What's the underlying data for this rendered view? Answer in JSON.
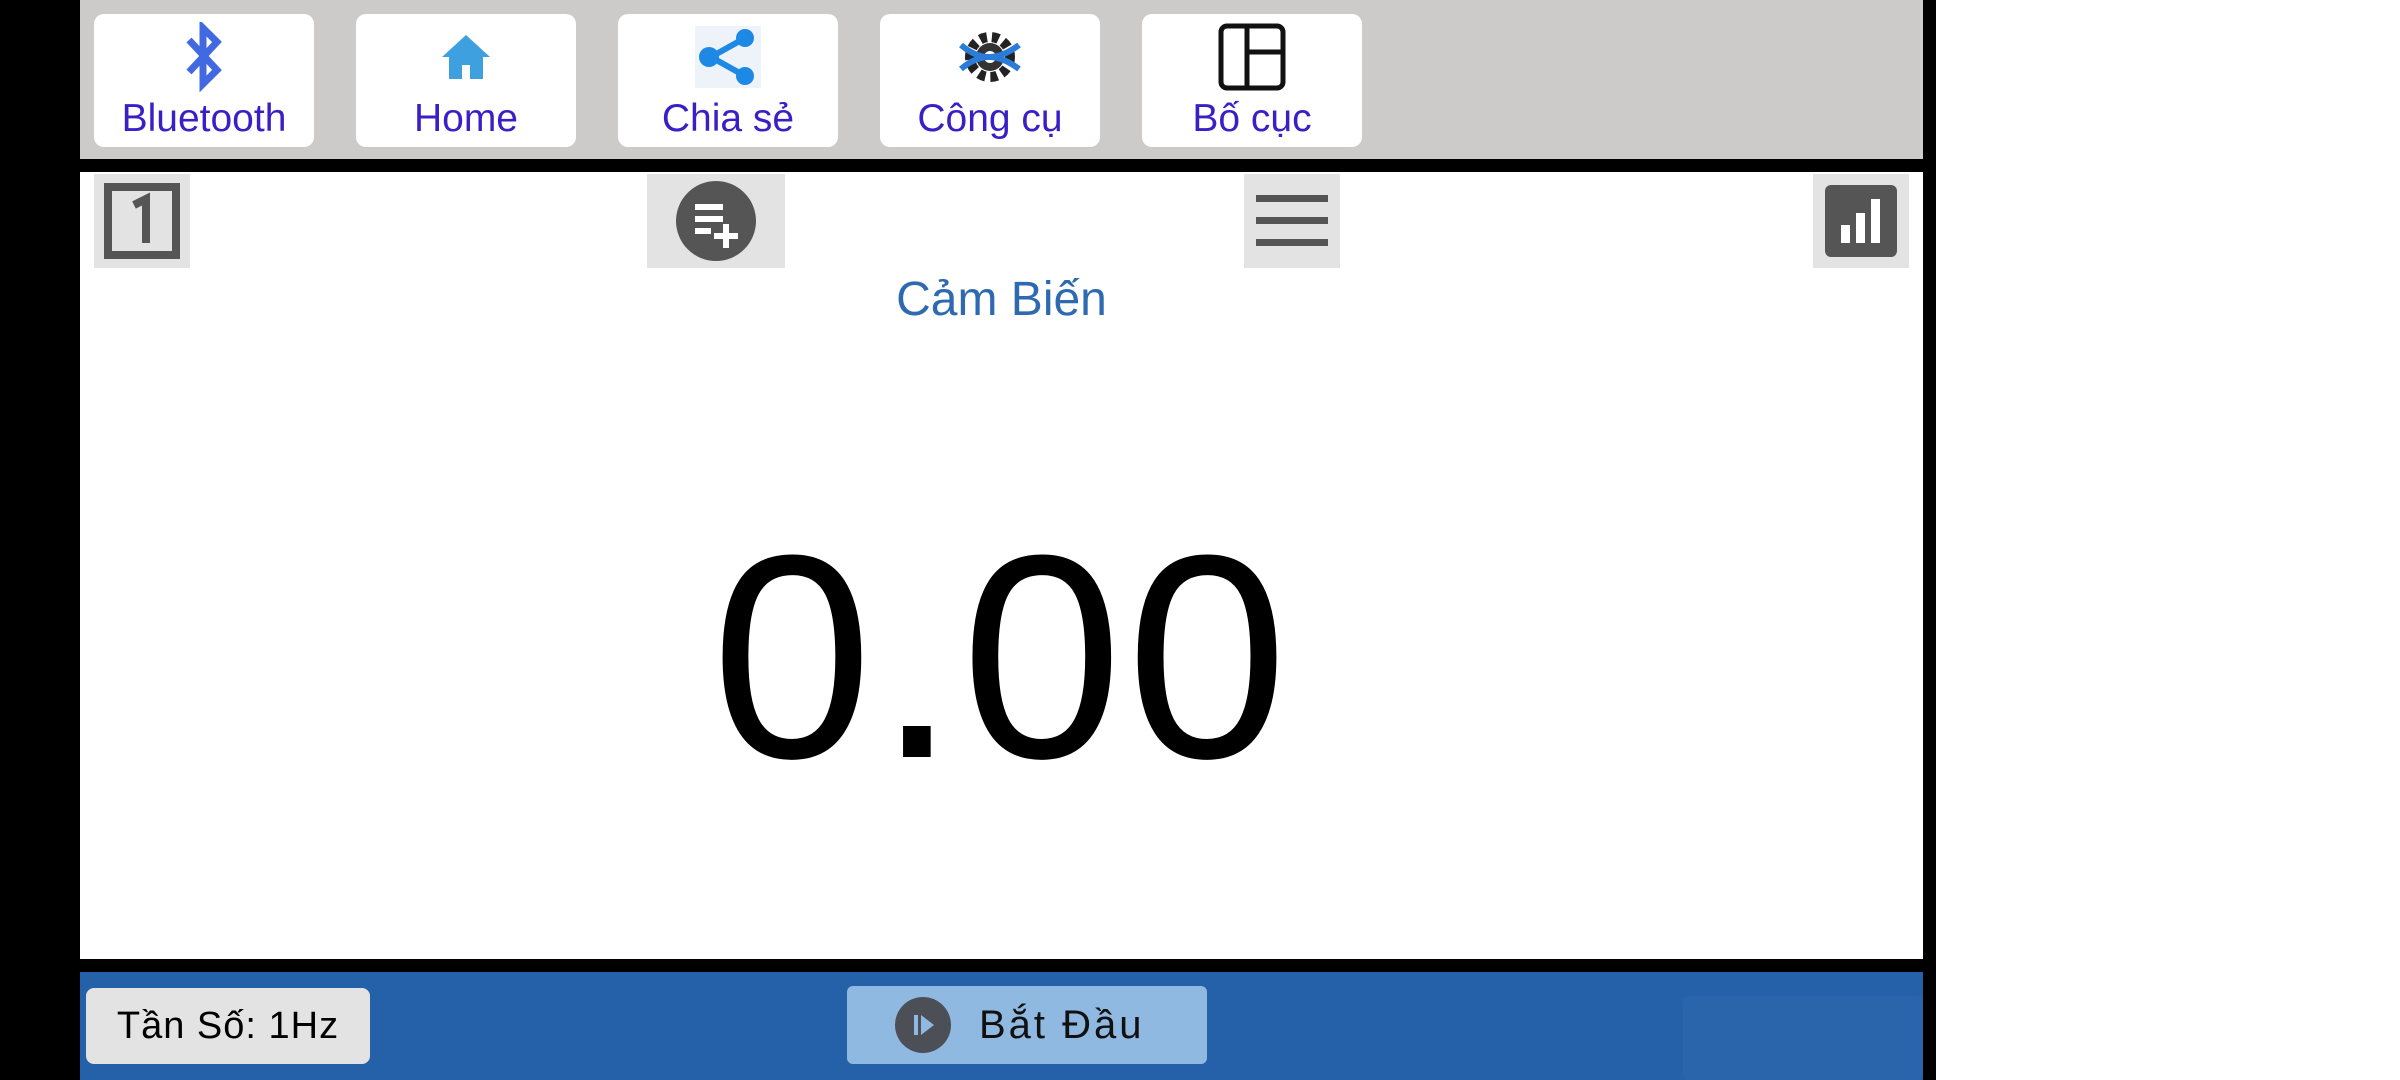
{
  "toolbar": {
    "bluetooth": "Bluetooth",
    "home": "Home",
    "share": "Chia sẻ",
    "tools": "Công cụ",
    "layout": "Bố cục"
  },
  "panel": {
    "title": "Cảm Biến",
    "value": "0.00",
    "number_icon": "1"
  },
  "bottom": {
    "frequency": "Tần Số: 1Hz",
    "start": "Bắt Đầu"
  },
  "colors": {
    "toolbar_bg": "#cdcaca",
    "label_color": "#3b1fc6",
    "title_color": "#2d6ab0",
    "bottom_bg": "#2561a8",
    "start_bg": "#8fb9e0"
  },
  "icons": [
    "bluetooth-icon",
    "home-icon",
    "share-icon",
    "tools-icon",
    "layout-icon",
    "number-one-icon",
    "add-list-icon",
    "menu-icon",
    "bar-chart-icon",
    "play-icon"
  ]
}
